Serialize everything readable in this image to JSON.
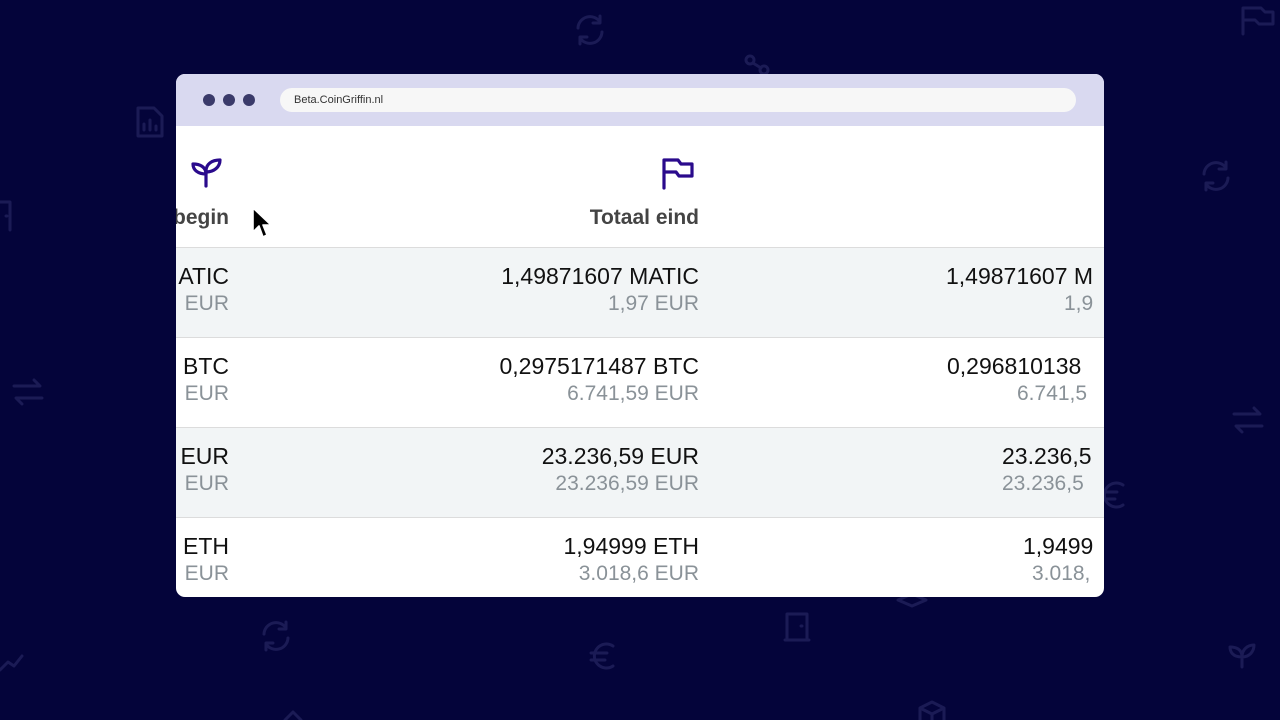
{
  "browser": {
    "url": "Beta.CoinGriffin.nl"
  },
  "columns": {
    "begin_label": "begin",
    "end_label": "Totaal eind"
  },
  "icons": {
    "begin": "sprout-icon",
    "end": "flag-icon",
    "cursor": "mouse-cursor-icon"
  },
  "rows": [
    {
      "begin_amount": "ATIC",
      "begin_eur": "EUR",
      "end_amount": "1,49871607 MATIC",
      "end_eur": "1,97 EUR",
      "next_amount": "1,49871607 M",
      "next_eur": "1,9"
    },
    {
      "begin_amount": "BTC",
      "begin_eur": "EUR",
      "end_amount": "0,2975171487 BTC",
      "end_eur": "6.741,59 EUR",
      "next_amount": "0,296810138",
      "next_eur": "6.741,5"
    },
    {
      "begin_amount": "EUR",
      "begin_eur": "EUR",
      "end_amount": "23.236,59 EUR",
      "end_eur": "23.236,59 EUR",
      "next_amount": "23.236,5",
      "next_eur": "23.236,5"
    },
    {
      "begin_amount": "ETH",
      "begin_eur": "EUR",
      "end_amount": "1,94999 ETH",
      "end_eur": "3.018,6 EUR",
      "next_amount": "1,9499",
      "next_eur": "3.018,"
    }
  ],
  "colors": {
    "background": "#04043a",
    "accent": "#2a0a8c",
    "chrome": "#d9d9f0"
  }
}
